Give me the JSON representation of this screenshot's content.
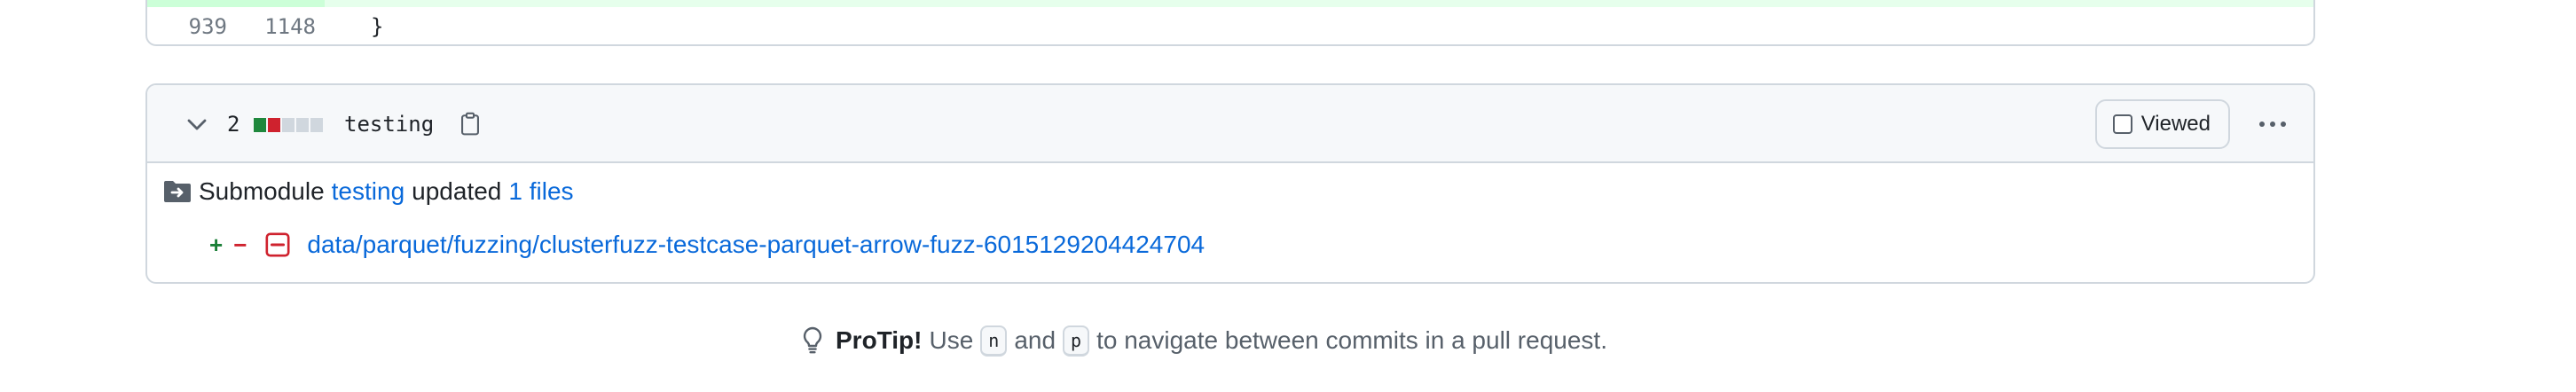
{
  "prev_file": {
    "old_line": "939",
    "new_line": "1148",
    "code": "}"
  },
  "file": {
    "changes_count": "2",
    "diffstat": [
      "add",
      "del",
      "neutral",
      "neutral",
      "neutral"
    ],
    "name": "testing",
    "viewed_label": "Viewed",
    "submodule": {
      "prefix": "Submodule",
      "name": "testing",
      "updated_text": "updated",
      "files_link": "1 files"
    },
    "entry": {
      "plus": "+",
      "minus": "−",
      "path": "data/parquet/fuzzing/clusterfuzz-testcase-parquet-arrow-fuzz-6015129204424704"
    }
  },
  "protip": {
    "label": "ProTip!",
    "use": "Use",
    "key1": "n",
    "and": "and",
    "key2": "p",
    "rest": "to navigate between commits in a pull request."
  },
  "colors": {
    "link": "#0969da",
    "add": "#1f883d",
    "delete": "#cf222e",
    "border": "#d0d7de",
    "header_bg": "#f6f8fa"
  },
  "icons": [
    "chevron-down-icon",
    "copy-icon",
    "file-submodule-icon",
    "diff-removed-icon",
    "light-bulb-icon",
    "kebab-horizontal-icon"
  ]
}
